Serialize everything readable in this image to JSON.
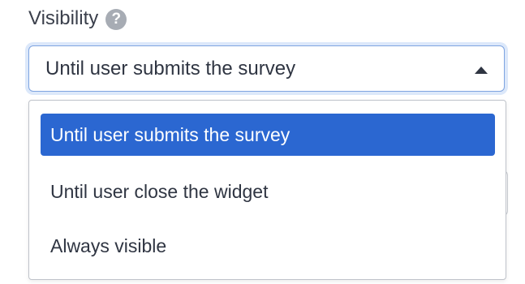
{
  "field": {
    "label": "Visibility",
    "help_icon": "?"
  },
  "select": {
    "value": "Until user submits the survey",
    "state": "open"
  },
  "dropdown": {
    "options": [
      {
        "label": "Until user submits the survey",
        "selected": true
      },
      {
        "label": "Until user close the widget",
        "selected": false
      },
      {
        "label": "Always visible",
        "selected": false
      }
    ]
  },
  "colors": {
    "selected_bg": "#2b67d1",
    "focus_border": "#7ea4e0",
    "help_icon_bg": "#a7acb4"
  }
}
